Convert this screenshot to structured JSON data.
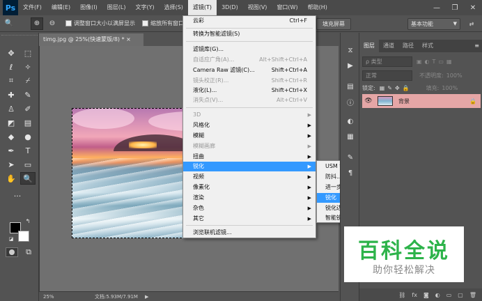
{
  "app": {
    "logo": "Ps"
  },
  "menubar": {
    "items": [
      "文件(F)",
      "编辑(E)",
      "图像(I)",
      "图层(L)",
      "文字(Y)",
      "选择(S)",
      "滤镜(T)",
      "3D(D)",
      "视图(V)",
      "窗口(W)",
      "帮助(H)"
    ],
    "active": "滤镜(T)"
  },
  "window_controls": {
    "minimize": "—",
    "restore": "❐",
    "close": "✕"
  },
  "optionsbar": {
    "checkbox1_label": "调整窗口大小以满屏显示",
    "checkbox2_label": "缩放所有窗口",
    "fill_screen_button": "填充屏幕",
    "workspace": "基本功能"
  },
  "document": {
    "tab_title": "timg.jpg @ 25%(快速蒙版/8) * ×",
    "zoom": "25%",
    "doc_info": "文档:5.93M/7.91M"
  },
  "filter_menu": {
    "items": [
      {
        "label": "云彩",
        "shortcut": "Ctrl+F",
        "disabled": false
      },
      {
        "label": "转换为智能滤镜(S)",
        "shortcut": "",
        "disabled": false
      },
      {
        "label": "滤镜库(G)...",
        "shortcut": "",
        "disabled": false
      },
      {
        "label": "自适应广角(A)...",
        "shortcut": "Alt+Shift+Ctrl+A",
        "disabled": true
      },
      {
        "label": "Camera Raw 滤镜(C)...",
        "shortcut": "Shift+Ctrl+A",
        "disabled": false
      },
      {
        "label": "镜头校正(R)...",
        "shortcut": "Shift+Ctrl+R",
        "disabled": true
      },
      {
        "label": "液化(L)...",
        "shortcut": "Shift+Ctrl+X",
        "disabled": false
      },
      {
        "label": "消失点(V)...",
        "shortcut": "Alt+Ctrl+V",
        "disabled": true
      },
      {
        "label": "3D",
        "disabled": true
      },
      {
        "label": "风格化",
        "disabled": false
      },
      {
        "label": "模糊",
        "disabled": false
      },
      {
        "label": "模糊画廊",
        "disabled": true
      },
      {
        "label": "扭曲",
        "disabled": false
      },
      {
        "label": "锐化",
        "disabled": false
      },
      {
        "label": "视频",
        "disabled": false
      },
      {
        "label": "像素化",
        "disabled": false
      },
      {
        "label": "渲染",
        "disabled": false
      },
      {
        "label": "杂色",
        "disabled": false
      },
      {
        "label": "其它",
        "disabled": false
      },
      {
        "label": "浏览联机滤镜...",
        "disabled": false
      }
    ],
    "highlighted": "锐化"
  },
  "sharpen_submenu": {
    "items": [
      "USM 锐化...",
      "防抖...",
      "进一步锐化",
      "锐化",
      "锐化边缘",
      "智能锐化..."
    ],
    "highlighted": "锐化"
  },
  "layers_panel": {
    "tabs": [
      "图层",
      "通道",
      "路径",
      "样式"
    ],
    "filter_kind": "ρ 类型",
    "blend_mode": "正常",
    "opacity_label": "不透明度:",
    "opacity_value": "100%",
    "lock_label": "锁定:",
    "fill_label": "填充:",
    "fill_value": "100%",
    "layer_name": "背景"
  },
  "watermark": {
    "title": "百科全说",
    "subtitle": "助你轻松解决"
  },
  "colors": {
    "highlight": "#3399ff",
    "layer_selected": "#e5a6a6",
    "watermark_green": "#2db34a"
  }
}
